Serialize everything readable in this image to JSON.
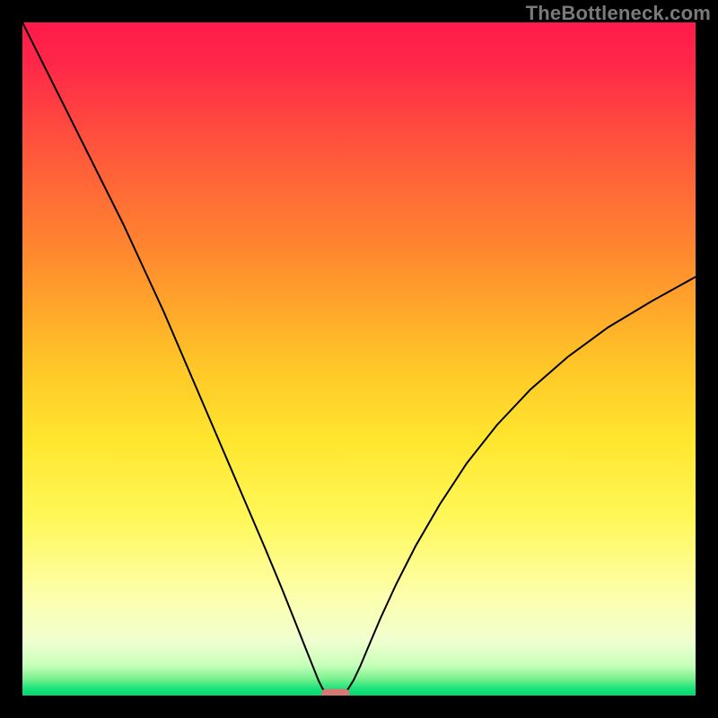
{
  "watermark": "TheBottleneck.com",
  "chart_data": {
    "type": "line",
    "title": "",
    "xlabel": "",
    "ylabel": "",
    "xlim": [
      0,
      100
    ],
    "ylim": [
      0,
      100
    ],
    "background_gradient": {
      "stops": [
        {
          "offset": 0.0,
          "color": "#ff1a4b"
        },
        {
          "offset": 0.06,
          "color": "#ff2749"
        },
        {
          "offset": 0.2,
          "color": "#ff5a3a"
        },
        {
          "offset": 0.35,
          "color": "#ff8b2e"
        },
        {
          "offset": 0.5,
          "color": "#ffc327"
        },
        {
          "offset": 0.62,
          "color": "#ffe62e"
        },
        {
          "offset": 0.74,
          "color": "#fff85a"
        },
        {
          "offset": 0.85,
          "color": "#fdffab"
        },
        {
          "offset": 0.92,
          "color": "#f0ffd0"
        },
        {
          "offset": 0.955,
          "color": "#c7ffba"
        },
        {
          "offset": 0.975,
          "color": "#7af08e"
        },
        {
          "offset": 0.99,
          "color": "#17e37a"
        },
        {
          "offset": 1.0,
          "color": "#06d46e"
        }
      ]
    },
    "series": [
      {
        "name": "bottleneck-curve",
        "color": "#000000",
        "stroke_width": 2,
        "x": [
          0,
          3,
          6,
          9,
          12,
          15,
          18,
          21,
          24,
          27,
          30,
          33,
          36,
          38.5,
          40.5,
          42,
          43.2,
          44,
          44.6,
          45.2,
          47.8,
          48.4,
          49.2,
          50.2,
          51.5,
          53.2,
          55.5,
          58.4,
          62,
          66,
          70.5,
          75.5,
          81,
          87,
          93.5,
          100
        ],
        "y": [
          100,
          94,
          88,
          82,
          76,
          70,
          63.5,
          57,
          50,
          43,
          36,
          29,
          22,
          16,
          11,
          7.2,
          4.2,
          2.2,
          1.0,
          0.4,
          0.4,
          1.0,
          2.3,
          4.4,
          7.5,
          11.5,
          16.5,
          22.2,
          28.4,
          34.5,
          40.2,
          45.5,
          50.3,
          54.7,
          58.6,
          62.2
        ]
      }
    ],
    "marker": {
      "name": "minimum-marker",
      "color": "#d47a73",
      "x": 46.5,
      "y": 0.3,
      "width": 4.2,
      "height": 1.4,
      "rx": 0.7
    }
  }
}
